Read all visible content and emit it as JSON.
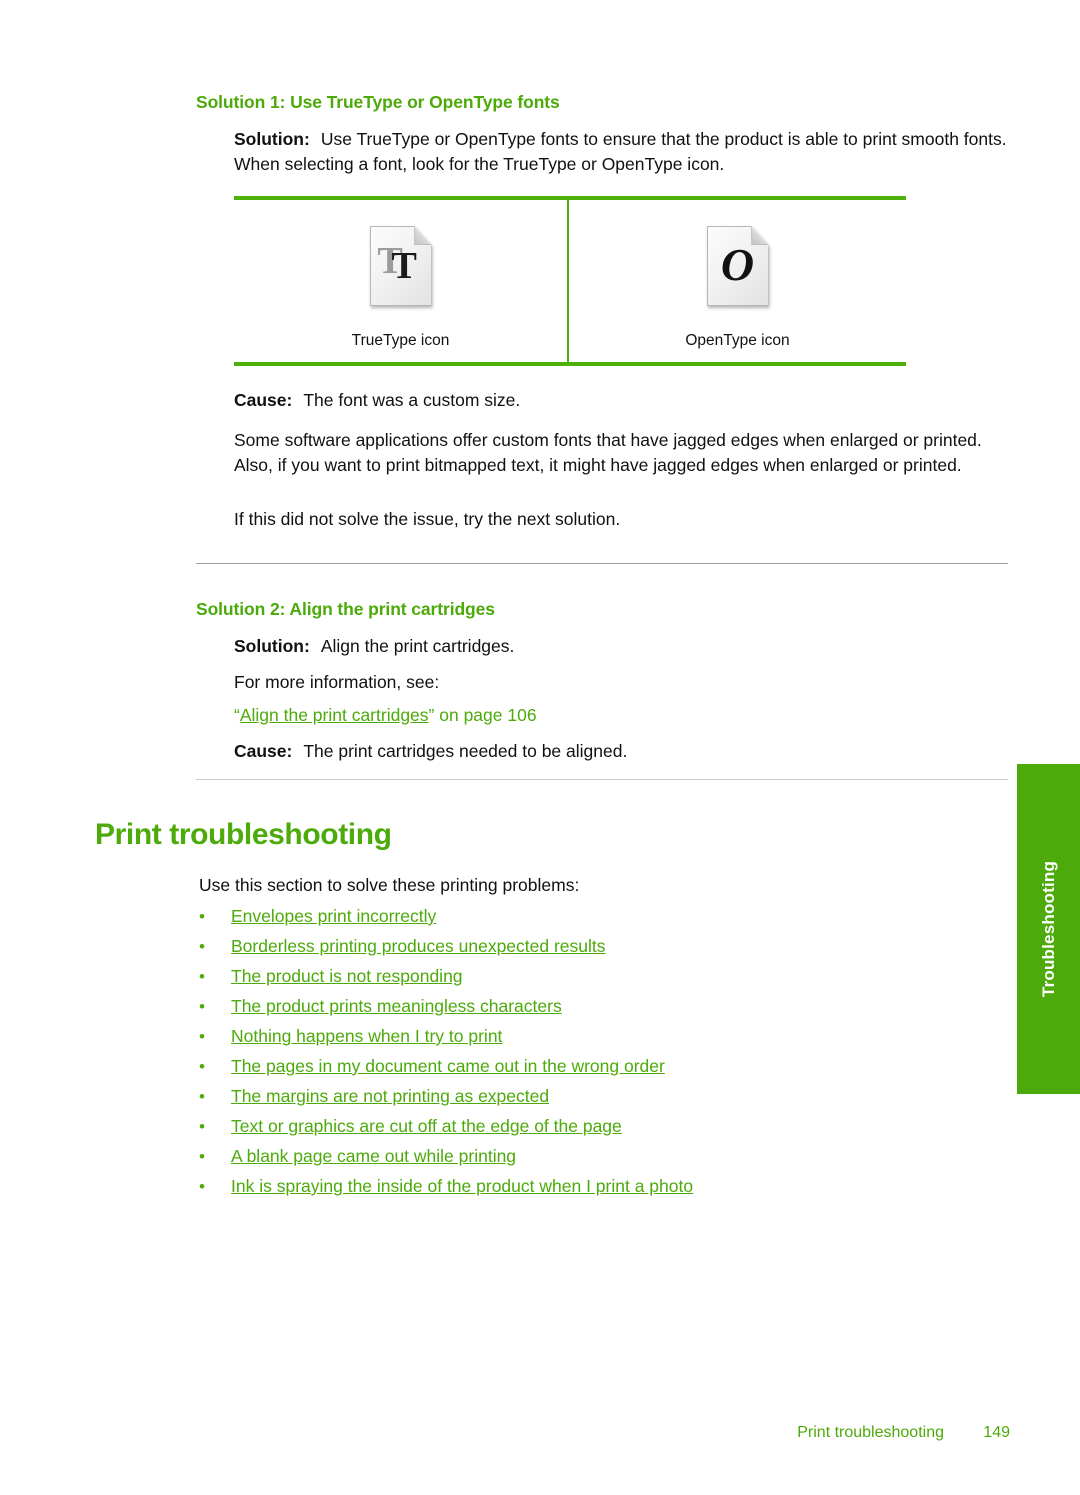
{
  "colors": {
    "accent_green": "#4CAA0A",
    "rule_green": "#4DB00B",
    "tab_green": "#4CAA0A",
    "body_text": "#111111",
    "separator": "#9a9ca0"
  },
  "side_tab": {
    "label": "Troubleshooting"
  },
  "solution1": {
    "heading": "Solution 1: Use TrueType or OpenType fonts",
    "solution_label": "Solution:",
    "solution_text": "Use TrueType or OpenType fonts to ensure that the product is able to print smooth fonts. When selecting a font, look for the TrueType or OpenType icon.",
    "table": {
      "left": {
        "icon_name": "truetype-icon",
        "glyph_back": "T",
        "glyph_front": "T",
        "caption": "TrueType icon"
      },
      "right": {
        "icon_name": "opentype-icon",
        "glyph": "O",
        "caption": "OpenType icon"
      }
    },
    "cause_label": "Cause:",
    "cause_text": "The font was a custom size.",
    "paragraph_1": "Some software applications offer custom fonts that have jagged edges when enlarged or printed. Also, if you want to print bitmapped text, it might have jagged edges when enlarged or printed.",
    "paragraph_2": "If this did not solve the issue, try the next solution."
  },
  "solution2": {
    "heading": "Solution 2: Align the print cartridges",
    "solution_label": "Solution:",
    "solution_text": "Align the print cartridges.",
    "more_info": "For more information, see:",
    "xref_open_quote": "“",
    "xref_link": "Align the print cartridges",
    "xref_close": "” on page 106",
    "cause_label": "Cause:",
    "cause_text": "The print cartridges needed to be aligned."
  },
  "print_troubleshooting": {
    "heading": "Print troubleshooting",
    "intro": "Use this section to solve these printing problems:",
    "bullet": "•",
    "links": [
      "Envelopes print incorrectly",
      "Borderless printing produces unexpected results",
      "The product is not responding",
      "The product prints meaningless characters",
      "Nothing happens when I try to print",
      "The pages in my document came out in the wrong order",
      "The margins are not printing as expected",
      "Text or graphics are cut off at the edge of the page",
      "A blank page came out while printing",
      "Ink is spraying the inside of the product when I print a photo"
    ]
  },
  "footer": {
    "title": "Print troubleshooting",
    "page_number": "149"
  }
}
